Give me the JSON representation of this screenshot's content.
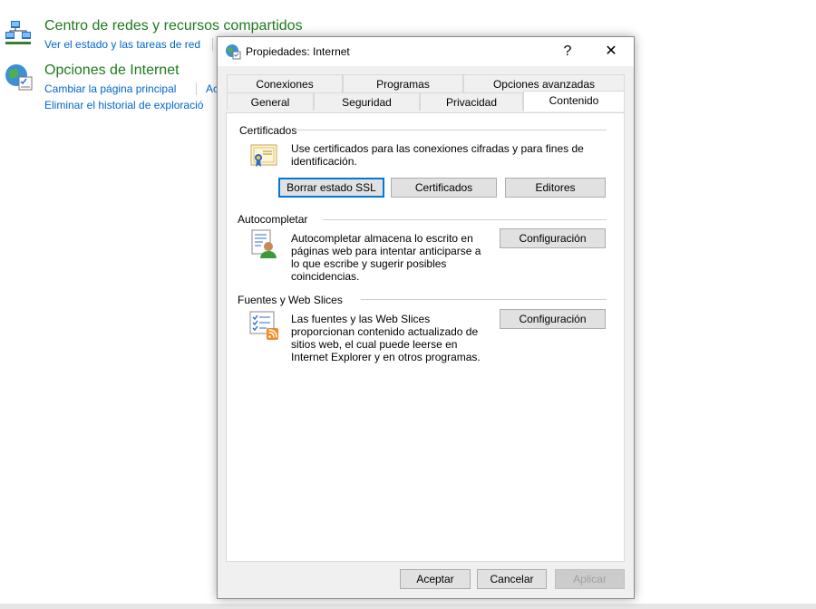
{
  "control_panel": {
    "network": {
      "title": "Centro de redes y recursos compartidos",
      "link1": "Ver el estado y las tareas de red"
    },
    "internet": {
      "title": "Opciones de Internet",
      "link1": "Cambiar la página principal",
      "link1_cut": "Ac",
      "link2": "Eliminar el historial de exploració"
    }
  },
  "dialog": {
    "title": "Propiedades: Internet",
    "help": "?",
    "close": "✕",
    "tabs_back": [
      "Conexiones",
      "Programas",
      "Opciones avanzadas"
    ],
    "tabs_front": [
      "General",
      "Seguridad",
      "Privacidad",
      "Contenido"
    ],
    "active_tab": "Contenido",
    "certificates": {
      "label": "Certificados",
      "description": "Use certificados para las conexiones cifradas y para fines de identificación.",
      "btn_clear_ssl": "Borrar estado SSL",
      "btn_certificates": "Certificados",
      "btn_publishers": "Editores"
    },
    "autocomplete": {
      "label": "Autocompletar",
      "description": "Autocompletar almacena lo escrito en páginas web para intentar anticiparse a lo que escribe y sugerir posibles coincidencias.",
      "btn_settings": "Configuración"
    },
    "feeds": {
      "label": "Fuentes y Web Slices",
      "description": "Las fuentes y las Web Slices proporcionan contenido actualizado de sitios web, el cual puede leerse en Internet Explorer y en otros programas.",
      "btn_settings": "Configuración"
    },
    "footer": {
      "ok": "Aceptar",
      "cancel": "Cancelar",
      "apply": "Aplicar"
    }
  },
  "colors": {
    "accent": "#0078d7",
    "link": "#0066cc",
    "heading_green": "#1e7b1e"
  }
}
